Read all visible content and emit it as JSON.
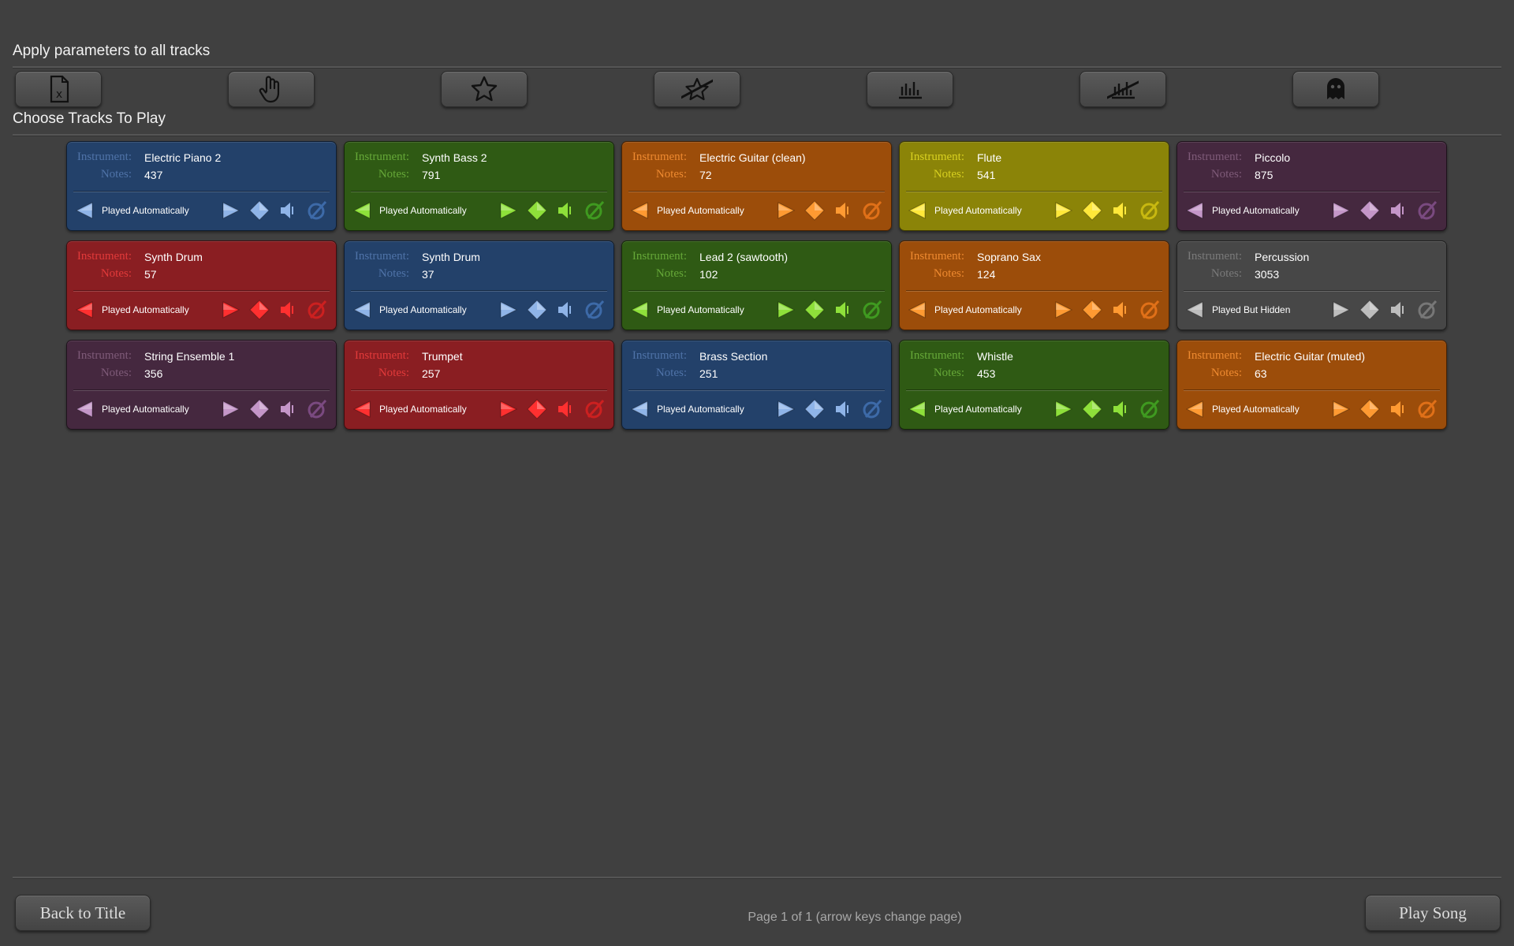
{
  "apply_section": {
    "title": "Apply parameters to all tracks",
    "buttons": [
      {
        "name": "excel-file-icon",
        "tooltip": ""
      },
      {
        "name": "hand-icon",
        "tooltip": ""
      },
      {
        "name": "star-icon",
        "tooltip": ""
      },
      {
        "name": "star-crossed-icon",
        "tooltip": ""
      },
      {
        "name": "bar-chart-icon",
        "tooltip": ""
      },
      {
        "name": "bar-chart-crossed-icon",
        "tooltip": ""
      },
      {
        "name": "ghost-icon",
        "tooltip": ""
      }
    ]
  },
  "tracks_section": {
    "title": "Choose Tracks To Play",
    "instrument_label": "Instrument:",
    "notes_label": "Notes:"
  },
  "tracks": [
    {
      "instrument": "Electric Piano 2",
      "notes": "437",
      "mode": "Played Automatically",
      "color": "blue"
    },
    {
      "instrument": "Synth Bass 2",
      "notes": "791",
      "mode": "Played Automatically",
      "color": "green"
    },
    {
      "instrument": "Electric Guitar (clean)",
      "notes": "72",
      "mode": "Played Automatically",
      "color": "orange"
    },
    {
      "instrument": "Flute",
      "notes": "541",
      "mode": "Played Automatically",
      "color": "yellow"
    },
    {
      "instrument": "Piccolo",
      "notes": "875",
      "mode": "Played Automatically",
      "color": "purple"
    },
    {
      "instrument": "Synth Drum",
      "notes": "57",
      "mode": "Played Automatically",
      "color": "red"
    },
    {
      "instrument": "Synth Drum",
      "notes": "37",
      "mode": "Played Automatically",
      "color": "blue"
    },
    {
      "instrument": "Lead 2 (sawtooth)",
      "notes": "102",
      "mode": "Played Automatically",
      "color": "green"
    },
    {
      "instrument": "Soprano Sax",
      "notes": "124",
      "mode": "Played Automatically",
      "color": "orange"
    },
    {
      "instrument": "Percussion",
      "notes": "3053",
      "mode": "Played But Hidden",
      "color": "gray"
    },
    {
      "instrument": "String Ensemble 1",
      "notes": "356",
      "mode": "Played Automatically",
      "color": "purple"
    },
    {
      "instrument": "Trumpet",
      "notes": "257",
      "mode": "Played Automatically",
      "color": "red"
    },
    {
      "instrument": "Brass Section",
      "notes": "251",
      "mode": "Played Automatically",
      "color": "blue"
    },
    {
      "instrument": "Whistle",
      "notes": "453",
      "mode": "Played Automatically",
      "color": "green"
    },
    {
      "instrument": "Electric Guitar (muted)",
      "notes": "63",
      "mode": "Played Automatically",
      "color": "orange"
    }
  ],
  "palette": {
    "blue": {
      "bg": "#23416a",
      "label": "#4f73a8",
      "icon": "#8fb4e8",
      "icon_dark": "#3d6aa8"
    },
    "green": {
      "bg": "#2f5a14",
      "label": "#66a838",
      "icon": "#8ee03a",
      "icon_dark": "#3f9a20"
    },
    "orange": {
      "bg": "#9c4d0a",
      "label": "#ee8a30",
      "icon": "#ff9a32",
      "icon_dark": "#e07018"
    },
    "yellow": {
      "bg": "#8b8408",
      "label": "#d8d020",
      "icon": "#ffe83a",
      "icon_dark": "#c8b810"
    },
    "purple": {
      "bg": "#45283f",
      "label": "#7e5a78",
      "icon": "#c496c8",
      "icon_dark": "#7a4a80"
    },
    "red": {
      "bg": "#8a1e22",
      "label": "#e23a3a",
      "icon": "#ff3030",
      "icon_dark": "#cc2020"
    },
    "gray": {
      "bg": "#474747",
      "label": "#7a7a7a",
      "icon": "#bdbdbd",
      "icon_dark": "#777777"
    }
  },
  "footer": {
    "back_label": "Back to Title",
    "page_info": "Page 1 of 1 (arrow keys change page)",
    "play_label": "Play Song"
  }
}
